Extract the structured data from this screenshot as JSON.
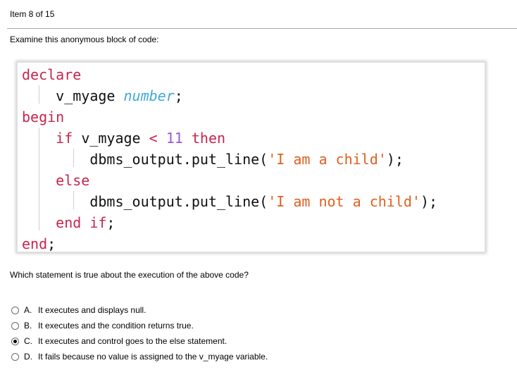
{
  "header": {
    "item_counter": "Item 8 of 15"
  },
  "prompt": "Examine this anonymous block of code:",
  "code": {
    "kw_declare": "declare",
    "var_decl": "v_myage",
    "type_number": "number",
    "semi": ";",
    "kw_begin": "begin",
    "kw_if": "if",
    "cond_var": "v_myage",
    "op_lt": "<",
    "num_11": "11",
    "kw_then": "then",
    "call": "dbms_output.put_line",
    "paren_open": "(",
    "str_child": "'I am a child'",
    "paren_close": ");",
    "kw_else": "else",
    "str_not_child": "'I am not a child'",
    "kw_end_if": "end if",
    "kw_end": "end"
  },
  "question": "Which statement is true about the execution of the above code?",
  "options": [
    {
      "letter": "A.",
      "text": "It executes and displays null.",
      "selected": false
    },
    {
      "letter": "B.",
      "text": "It executes and the condition returns true.",
      "selected": false
    },
    {
      "letter": "C.",
      "text": "It executes and control goes to the else statement.",
      "selected": true
    },
    {
      "letter": "D.",
      "text": "It fails because no value is assigned to the v_myage variable.",
      "selected": false
    }
  ],
  "colors": {
    "keyword": "#c7254e",
    "type": "#3fa9d8",
    "number": "#9b59d0",
    "string": "#e0601f"
  }
}
